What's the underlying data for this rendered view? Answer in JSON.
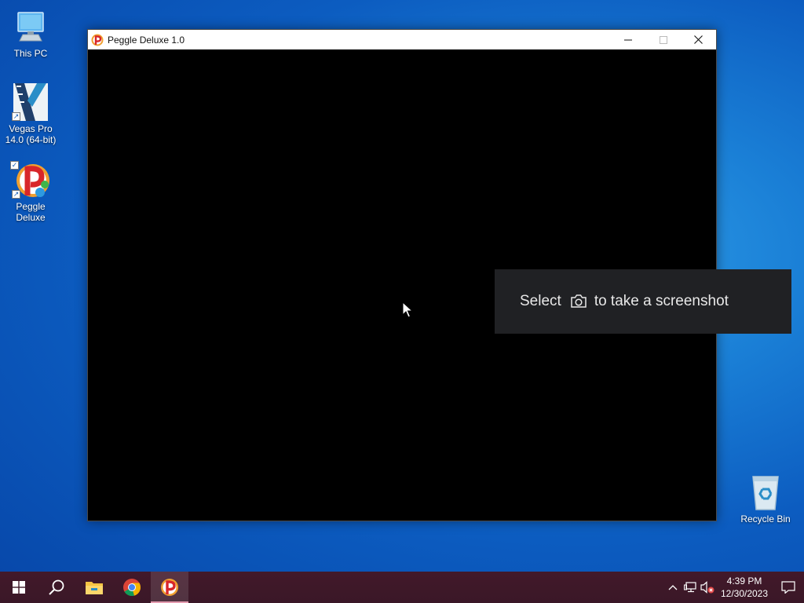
{
  "desktop": {
    "icons": [
      {
        "name": "this-pc",
        "label": "This PC"
      },
      {
        "name": "vegas-pro",
        "label": "Vegas Pro 14.0 (64-bit)"
      },
      {
        "name": "peggle-deluxe",
        "label": "Peggle Deluxe"
      },
      {
        "name": "recycle-bin",
        "label": "Recycle Bin"
      }
    ]
  },
  "window": {
    "title": "Peggle Deluxe 1.0",
    "icon": "peggle-icon"
  },
  "toast": {
    "text_before": "Select",
    "icon": "camera-icon",
    "text_after": "to take a screenshot"
  },
  "taskbar": {
    "apps": [
      "start-icon",
      "search-icon",
      "file-explorer-icon",
      "chrome-icon",
      "peggle-icon"
    ],
    "tray": {
      "time": "4:39 PM",
      "date": "12/30/2023"
    }
  },
  "colors": {
    "taskbar": "#3a1727",
    "accent": "#e49bb0",
    "toast_bg": "#202124"
  }
}
